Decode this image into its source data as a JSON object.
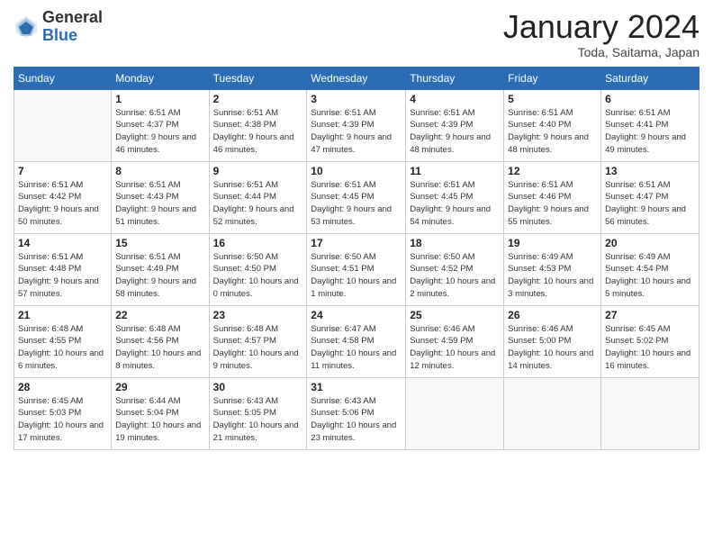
{
  "logo": {
    "general": "General",
    "blue": "Blue"
  },
  "title": "January 2024",
  "subtitle": "Toda, Saitama, Japan",
  "weekdays": [
    "Sunday",
    "Monday",
    "Tuesday",
    "Wednesday",
    "Thursday",
    "Friday",
    "Saturday"
  ],
  "weeks": [
    [
      {
        "day": "",
        "sunrise": "",
        "sunset": "",
        "daylight": ""
      },
      {
        "day": "1",
        "sunrise": "Sunrise: 6:51 AM",
        "sunset": "Sunset: 4:37 PM",
        "daylight": "Daylight: 9 hours and 46 minutes."
      },
      {
        "day": "2",
        "sunrise": "Sunrise: 6:51 AM",
        "sunset": "Sunset: 4:38 PM",
        "daylight": "Daylight: 9 hours and 46 minutes."
      },
      {
        "day": "3",
        "sunrise": "Sunrise: 6:51 AM",
        "sunset": "Sunset: 4:39 PM",
        "daylight": "Daylight: 9 hours and 47 minutes."
      },
      {
        "day": "4",
        "sunrise": "Sunrise: 6:51 AM",
        "sunset": "Sunset: 4:39 PM",
        "daylight": "Daylight: 9 hours and 48 minutes."
      },
      {
        "day": "5",
        "sunrise": "Sunrise: 6:51 AM",
        "sunset": "Sunset: 4:40 PM",
        "daylight": "Daylight: 9 hours and 48 minutes."
      },
      {
        "day": "6",
        "sunrise": "Sunrise: 6:51 AM",
        "sunset": "Sunset: 4:41 PM",
        "daylight": "Daylight: 9 hours and 49 minutes."
      }
    ],
    [
      {
        "day": "7",
        "sunrise": "Sunrise: 6:51 AM",
        "sunset": "Sunset: 4:42 PM",
        "daylight": "Daylight: 9 hours and 50 minutes."
      },
      {
        "day": "8",
        "sunrise": "Sunrise: 6:51 AM",
        "sunset": "Sunset: 4:43 PM",
        "daylight": "Daylight: 9 hours and 51 minutes."
      },
      {
        "day": "9",
        "sunrise": "Sunrise: 6:51 AM",
        "sunset": "Sunset: 4:44 PM",
        "daylight": "Daylight: 9 hours and 52 minutes."
      },
      {
        "day": "10",
        "sunrise": "Sunrise: 6:51 AM",
        "sunset": "Sunset: 4:45 PM",
        "daylight": "Daylight: 9 hours and 53 minutes."
      },
      {
        "day": "11",
        "sunrise": "Sunrise: 6:51 AM",
        "sunset": "Sunset: 4:45 PM",
        "daylight": "Daylight: 9 hours and 54 minutes."
      },
      {
        "day": "12",
        "sunrise": "Sunrise: 6:51 AM",
        "sunset": "Sunset: 4:46 PM",
        "daylight": "Daylight: 9 hours and 55 minutes."
      },
      {
        "day": "13",
        "sunrise": "Sunrise: 6:51 AM",
        "sunset": "Sunset: 4:47 PM",
        "daylight": "Daylight: 9 hours and 56 minutes."
      }
    ],
    [
      {
        "day": "14",
        "sunrise": "Sunrise: 6:51 AM",
        "sunset": "Sunset: 4:48 PM",
        "daylight": "Daylight: 9 hours and 57 minutes."
      },
      {
        "day": "15",
        "sunrise": "Sunrise: 6:51 AM",
        "sunset": "Sunset: 4:49 PM",
        "daylight": "Daylight: 9 hours and 58 minutes."
      },
      {
        "day": "16",
        "sunrise": "Sunrise: 6:50 AM",
        "sunset": "Sunset: 4:50 PM",
        "daylight": "Daylight: 10 hours and 0 minutes."
      },
      {
        "day": "17",
        "sunrise": "Sunrise: 6:50 AM",
        "sunset": "Sunset: 4:51 PM",
        "daylight": "Daylight: 10 hours and 1 minute."
      },
      {
        "day": "18",
        "sunrise": "Sunrise: 6:50 AM",
        "sunset": "Sunset: 4:52 PM",
        "daylight": "Daylight: 10 hours and 2 minutes."
      },
      {
        "day": "19",
        "sunrise": "Sunrise: 6:49 AM",
        "sunset": "Sunset: 4:53 PM",
        "daylight": "Daylight: 10 hours and 3 minutes."
      },
      {
        "day": "20",
        "sunrise": "Sunrise: 6:49 AM",
        "sunset": "Sunset: 4:54 PM",
        "daylight": "Daylight: 10 hours and 5 minutes."
      }
    ],
    [
      {
        "day": "21",
        "sunrise": "Sunrise: 6:48 AM",
        "sunset": "Sunset: 4:55 PM",
        "daylight": "Daylight: 10 hours and 6 minutes."
      },
      {
        "day": "22",
        "sunrise": "Sunrise: 6:48 AM",
        "sunset": "Sunset: 4:56 PM",
        "daylight": "Daylight: 10 hours and 8 minutes."
      },
      {
        "day": "23",
        "sunrise": "Sunrise: 6:48 AM",
        "sunset": "Sunset: 4:57 PM",
        "daylight": "Daylight: 10 hours and 9 minutes."
      },
      {
        "day": "24",
        "sunrise": "Sunrise: 6:47 AM",
        "sunset": "Sunset: 4:58 PM",
        "daylight": "Daylight: 10 hours and 11 minutes."
      },
      {
        "day": "25",
        "sunrise": "Sunrise: 6:46 AM",
        "sunset": "Sunset: 4:59 PM",
        "daylight": "Daylight: 10 hours and 12 minutes."
      },
      {
        "day": "26",
        "sunrise": "Sunrise: 6:46 AM",
        "sunset": "Sunset: 5:00 PM",
        "daylight": "Daylight: 10 hours and 14 minutes."
      },
      {
        "day": "27",
        "sunrise": "Sunrise: 6:45 AM",
        "sunset": "Sunset: 5:02 PM",
        "daylight": "Daylight: 10 hours and 16 minutes."
      }
    ],
    [
      {
        "day": "28",
        "sunrise": "Sunrise: 6:45 AM",
        "sunset": "Sunset: 5:03 PM",
        "daylight": "Daylight: 10 hours and 17 minutes."
      },
      {
        "day": "29",
        "sunrise": "Sunrise: 6:44 AM",
        "sunset": "Sunset: 5:04 PM",
        "daylight": "Daylight: 10 hours and 19 minutes."
      },
      {
        "day": "30",
        "sunrise": "Sunrise: 6:43 AM",
        "sunset": "Sunset: 5:05 PM",
        "daylight": "Daylight: 10 hours and 21 minutes."
      },
      {
        "day": "31",
        "sunrise": "Sunrise: 6:43 AM",
        "sunset": "Sunset: 5:06 PM",
        "daylight": "Daylight: 10 hours and 23 minutes."
      },
      {
        "day": "",
        "sunrise": "",
        "sunset": "",
        "daylight": ""
      },
      {
        "day": "",
        "sunrise": "",
        "sunset": "",
        "daylight": ""
      },
      {
        "day": "",
        "sunrise": "",
        "sunset": "",
        "daylight": ""
      }
    ]
  ]
}
